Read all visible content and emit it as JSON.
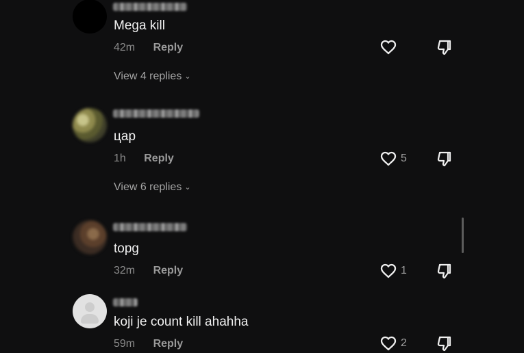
{
  "comments": [
    {
      "text": "Mega kill",
      "time": "42m",
      "reply_label": "Reply",
      "replies_label": "View 4 replies",
      "like_count": ""
    },
    {
      "text": "цар",
      "time": "1h",
      "reply_label": "Reply",
      "replies_label": "View 6 replies",
      "like_count": "5"
    },
    {
      "text": "topg",
      "time": "32m",
      "reply_label": "Reply",
      "replies_label": "",
      "like_count": "1"
    },
    {
      "text": "koji je count kill ahahha",
      "time": "59m",
      "reply_label": "Reply",
      "replies_label": "",
      "like_count": "2"
    }
  ],
  "icons": {
    "like": "heart-icon",
    "dislike": "thumbs-down-icon",
    "chevron": "chevron-down-icon"
  },
  "colors": {
    "background": "#0f0f10",
    "text": "#f1f1f1",
    "muted": "#8b8b8b"
  }
}
